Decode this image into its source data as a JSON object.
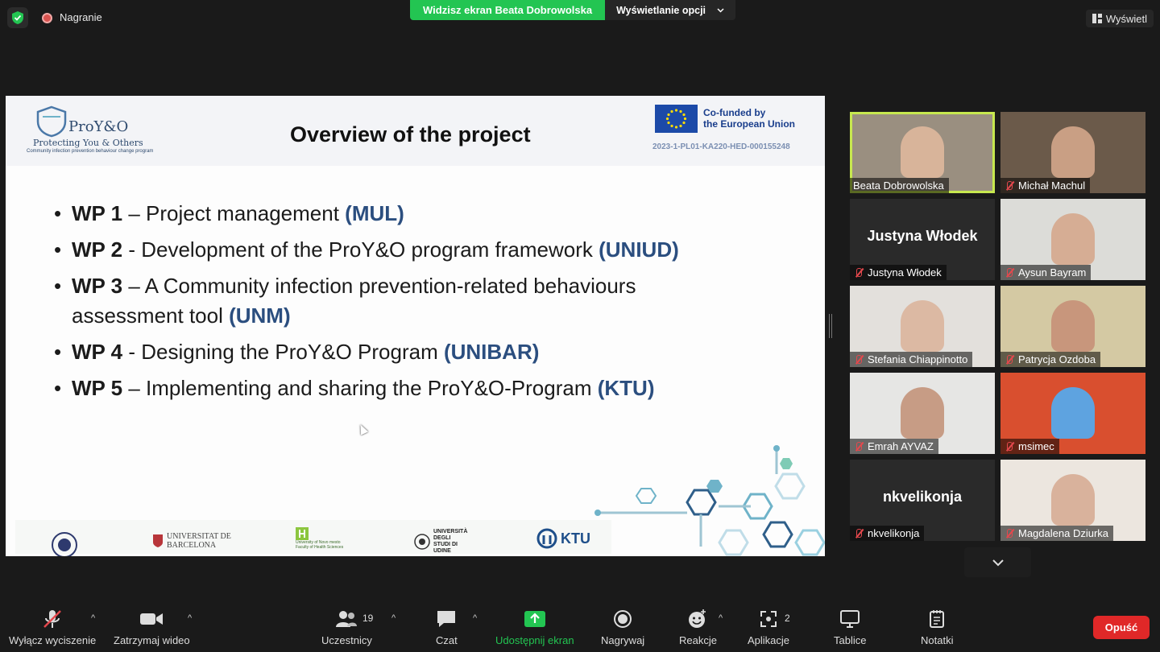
{
  "topbar": {
    "recording_label": "Nagranie",
    "share_banner": "Widzisz ekran Beata Dobrowolska",
    "view_options": "Wyświetlanie opcji",
    "view_button": "Wyświetl"
  },
  "slide": {
    "logo_name": "ProY&O",
    "logo_tagline": "Protecting You & Others",
    "logo_subtitle": "Community infection prevention behaviour change program",
    "title": "Overview of the project",
    "eu_line1": "Co-funded by",
    "eu_line2": "the European Union",
    "project_code": "2023-1-PL01-KA220-HED-000155248",
    "bullets": [
      {
        "wp": "WP 1",
        "text": " – Project management ",
        "org": "(MUL)"
      },
      {
        "wp": "WP 2",
        "text": " - Development of the ProY&O program framework ",
        "org": "(UNIUD)"
      },
      {
        "wp": "WP 3",
        "text": " – A Community infection prevention-related behaviours assessment tool ",
        "org": "(UNM)"
      },
      {
        "wp": "WP 4",
        "text": " - Designing the ProY&O Program ",
        "org": "(UNIBAR)"
      },
      {
        "wp": "WP 5",
        "text": " – Implementing and sharing the ProY&O-Program ",
        "org": "(KTU)"
      }
    ],
    "partners": [
      "UNIVERSITAT DE BARCELONA",
      "University of Novo mesto Faculty of Health Sciences",
      "UNIVERSITÀ DEGLI STUDI DI UDINE",
      "KTU"
    ]
  },
  "participants": [
    {
      "name": "Beata Dobrowolska",
      "muted": false,
      "active": true,
      "video": true,
      "bg": "#9a8f80",
      "skin": "#d8b49a"
    },
    {
      "name": "Michał Machul",
      "muted": true,
      "active": false,
      "video": true,
      "bg": "#6b5a4a",
      "skin": "#c99f84"
    },
    {
      "name": "Justyna Włodek",
      "muted": true,
      "active": false,
      "video": false
    },
    {
      "name": "Aysun Bayram",
      "muted": true,
      "active": false,
      "video": true,
      "bg": "#dcdcd8",
      "skin": "#d6ad94"
    },
    {
      "name": "Stefania Chiappinotto",
      "muted": true,
      "active": false,
      "video": true,
      "bg": "#e3e0dc",
      "skin": "#dcb9a3"
    },
    {
      "name": "Patrycja Ozdoba",
      "muted": true,
      "active": false,
      "video": true,
      "bg": "#d4c9a3",
      "skin": "#c8967c"
    },
    {
      "name": "Emrah AYVAZ",
      "muted": true,
      "active": false,
      "video": true,
      "bg": "#e6e6e4",
      "skin": "#c79c85"
    },
    {
      "name": "msimec",
      "muted": true,
      "active": false,
      "video": true,
      "bg": "#d94f2f",
      "skin": "#5ea3e0"
    },
    {
      "name": "nkvelikonja",
      "muted": true,
      "active": false,
      "video": false
    },
    {
      "name": "Magdalena Dziurka",
      "muted": true,
      "active": false,
      "video": true,
      "bg": "#ece6df",
      "skin": "#d9b29c"
    }
  ],
  "toolbar": {
    "mute": "Wyłącz wyciszenie",
    "video": "Zatrzymaj wideo",
    "participants": "Uczestnicy",
    "participants_count": "19",
    "chat": "Czat",
    "share": "Udostępnij ekran",
    "record": "Nagrywaj",
    "reactions": "Reakcje",
    "apps": "Aplikacje",
    "apps_count": "2",
    "whiteboards": "Tablice",
    "notes": "Notatki",
    "leave": "Opuść"
  }
}
